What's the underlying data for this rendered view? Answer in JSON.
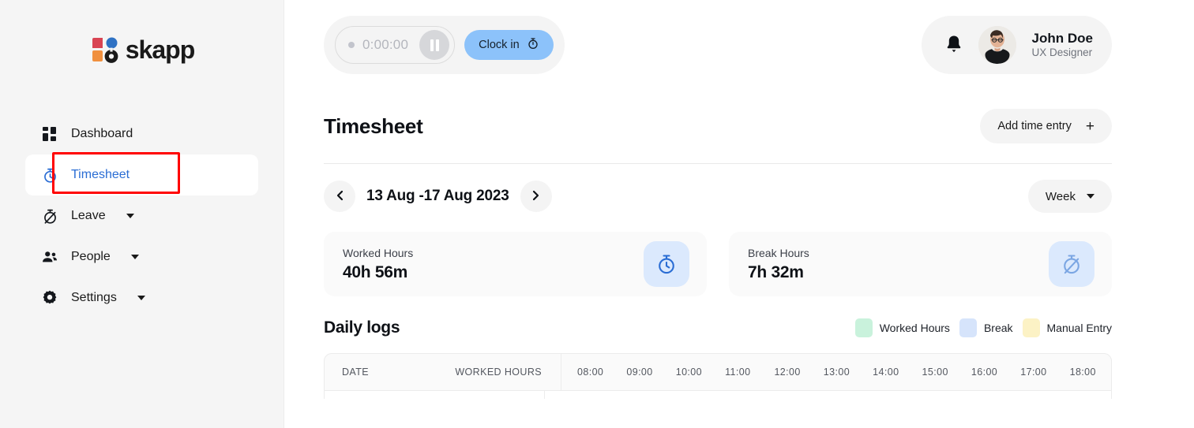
{
  "brand": {
    "name": "skapp",
    "logo_icon": "skapp-logo-icon"
  },
  "sidebar": {
    "items": [
      {
        "label": "Dashboard",
        "icon": "grid-icon",
        "active": false,
        "expandable": false
      },
      {
        "label": "Timesheet",
        "icon": "stopwatch-icon",
        "active": true,
        "expandable": false
      },
      {
        "label": "Leave",
        "icon": "stopwatch-off-icon",
        "active": false,
        "expandable": true
      },
      {
        "label": "People",
        "icon": "people-icon",
        "active": false,
        "expandable": true
      },
      {
        "label": "Settings",
        "icon": "gear-icon",
        "active": false,
        "expandable": true
      }
    ],
    "highlight_color": "#ff0000"
  },
  "topbar": {
    "timer": {
      "value": "0:00:00",
      "status_dot": "idle-dot",
      "pause_icon": "pause-icon"
    },
    "clock_in": {
      "label": "Clock in",
      "icon": "stopwatch-icon",
      "color": "#8cc2fa"
    },
    "notifications_icon": "bell-icon",
    "profile": {
      "name": "John Doe",
      "role": "UX Designer",
      "avatar": "user-avatar"
    }
  },
  "page": {
    "title": "Timesheet",
    "add_entry": {
      "label": "Add time entry",
      "icon": "plus-icon"
    }
  },
  "date_nav": {
    "prev_icon": "chevron-left-icon",
    "next_icon": "chevron-right-icon",
    "range": "13 Aug -17 Aug 2023",
    "period": {
      "selected": "Week",
      "icon": "chevron-down-icon"
    }
  },
  "stats": [
    {
      "label": "Worked Hours",
      "value": "40h 56m",
      "icon": "stopwatch-icon",
      "icon_bg": "#dbe9fd",
      "icon_color": "#2a6dd4"
    },
    {
      "label": "Break Hours",
      "value": "7h 32m",
      "icon": "stopwatch-off-icon",
      "icon_bg": "#dbe9fd",
      "icon_color": "#6f9fe0"
    }
  ],
  "daily_logs": {
    "title": "Daily logs",
    "legend": [
      {
        "label": "Worked Hours",
        "color": "#c9f2dc"
      },
      {
        "label": "Break",
        "color": "#d6e4fb"
      },
      {
        "label": "Manual Entry",
        "color": "#fcf2c5"
      }
    ],
    "table": {
      "columns": [
        "DATE",
        "WORKED HOURS"
      ],
      "time_columns": [
        "08:00",
        "09:00",
        "10:00",
        "11:00",
        "12:00",
        "13:00",
        "14:00",
        "15:00",
        "16:00",
        "17:00",
        "18:00"
      ],
      "rows": []
    }
  }
}
